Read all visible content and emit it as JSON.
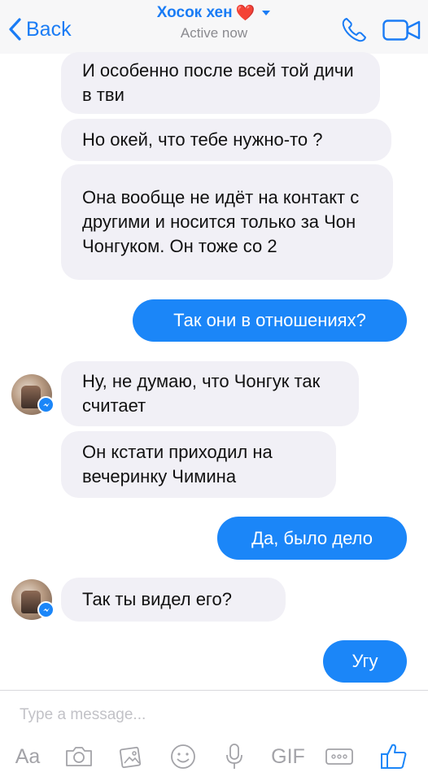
{
  "header": {
    "back_label": "Back",
    "contact_name": "Хосок хен",
    "heart": "❤️",
    "status": "Active now"
  },
  "messages": [
    {
      "side": "in",
      "text": "И особенно после всей той дичи в тви"
    },
    {
      "side": "in",
      "text": "Но окей, что тебе нужно-то ?"
    },
    {
      "side": "in",
      "text": "Она вообще не идёт на контакт с другими и носится только за Чон Чонгуком. Он тоже со 2"
    },
    {
      "side": "out",
      "text": "Так они в отношениях?"
    },
    {
      "side": "in",
      "text": "Ну, не думаю, что Чонгук так считает"
    },
    {
      "side": "in",
      "text": "Он кстати приходил на вечеринку Чимина"
    },
    {
      "side": "out",
      "text": "Да, было дело"
    },
    {
      "side": "in",
      "text": "Так ты видел его?"
    },
    {
      "side": "out",
      "text": "Угу"
    }
  ],
  "composer": {
    "placeholder": "Type a message..."
  },
  "toolbar": {
    "aa_label": "Aa",
    "gif_label": "GIF",
    "icons": [
      "camera-icon",
      "gallery-icon",
      "emoji-icon",
      "microphone-icon",
      "more-icon",
      "like-icon"
    ]
  },
  "colors": {
    "accent": "#1b86f8",
    "incoming_bubble": "#f1f0f6",
    "header_bg": "#f7f7f8",
    "icon_gray": "#a3a3a8"
  }
}
